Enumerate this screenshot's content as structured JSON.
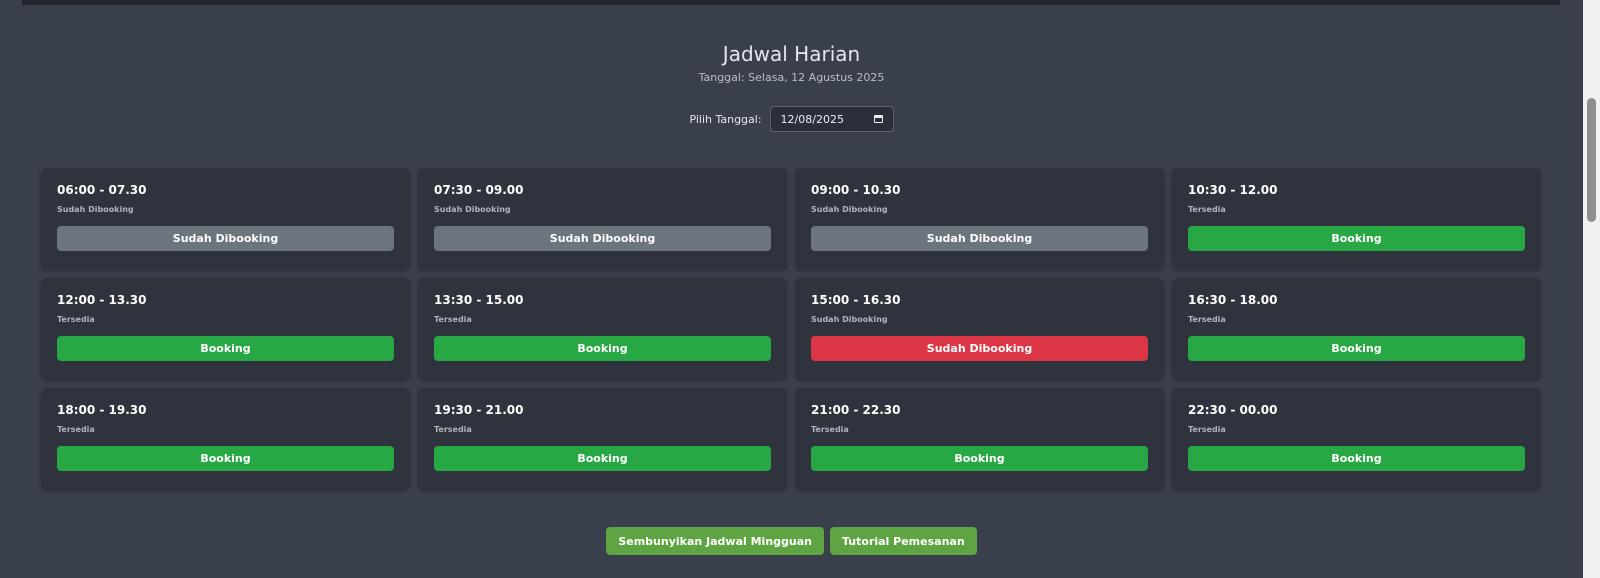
{
  "header": {
    "title": "Jadwal Harian",
    "date_text": "Tanggal: Selasa, 12 Agustus 2025"
  },
  "date_picker": {
    "label": "Pilih Tanggal:",
    "value": "12/08/2025"
  },
  "slots": [
    {
      "time": "06:00 - 07.30",
      "status": "Sudah Dibooking",
      "button": "Sudah Dibooking",
      "button_color": "#6c747e"
    },
    {
      "time": "07:30 - 09.00",
      "status": "Sudah Dibooking",
      "button": "Sudah Dibooking",
      "button_color": "#6c747e"
    },
    {
      "time": "09:00 - 10.30",
      "status": "Sudah Dibooking",
      "button": "Sudah Dibooking",
      "button_color": "#6c747e"
    },
    {
      "time": "10:30 - 12.00",
      "status": "Tersedia",
      "button": "Booking",
      "button_color": "#28a745"
    },
    {
      "time": "12:00 - 13.30",
      "status": "Tersedia",
      "button": "Booking",
      "button_color": "#28a745"
    },
    {
      "time": "13:30 - 15.00",
      "status": "Tersedia",
      "button": "Booking",
      "button_color": "#28a745"
    },
    {
      "time": "15:00 - 16.30",
      "status": "Sudah Dibooking",
      "button": "Sudah Dibooking",
      "button_color": "#dc3545"
    },
    {
      "time": "16:30 - 18.00",
      "status": "Tersedia",
      "button": "Booking",
      "button_color": "#28a745"
    },
    {
      "time": "18:00 - 19.30",
      "status": "Tersedia",
      "button": "Booking",
      "button_color": "#28a745"
    },
    {
      "time": "19:30 - 21.00",
      "status": "Tersedia",
      "button": "Booking",
      "button_color": "#28a745"
    },
    {
      "time": "21:00 - 22.30",
      "status": "Tersedia",
      "button": "Booking",
      "button_color": "#28a745"
    },
    {
      "time": "22:30 - 00.00",
      "status": "Tersedia",
      "button": "Booking",
      "button_color": "#28a745"
    }
  ],
  "actions": {
    "hide_weekly": "Sembunyikan Jadwal Mingguan",
    "tutorial": "Tutorial Pemesanan"
  },
  "icons": {
    "date_input_icon": "calendar-icon"
  }
}
